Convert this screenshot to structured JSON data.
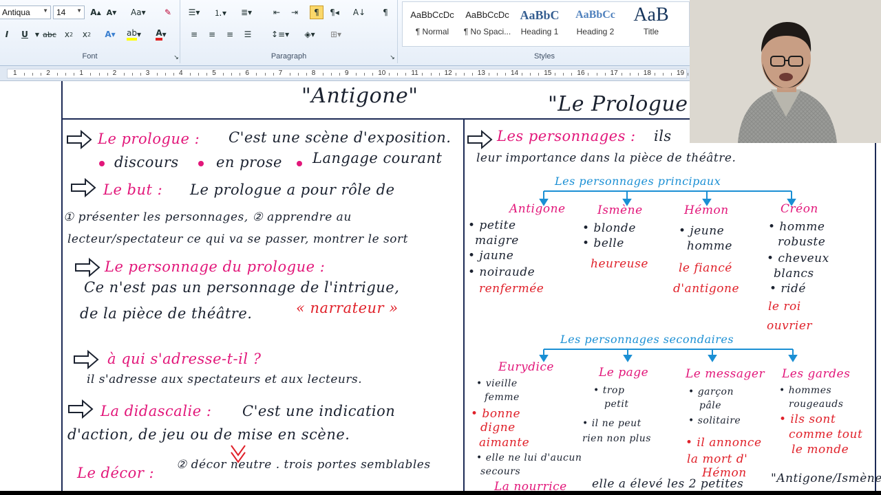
{
  "ribbon": {
    "font": {
      "font_name": "Antiqua",
      "font_size": "14",
      "group_label": "Font"
    },
    "paragraph": {
      "group_label": "Paragraph"
    },
    "styles": {
      "group_label": "Styles",
      "items": [
        {
          "sample": "AaBbCcDc",
          "name": "¶ Normal"
        },
        {
          "sample": "AaBbCcDc",
          "name": "¶ No Spaci..."
        },
        {
          "sample": "AaBbC",
          "name": "Heading 1"
        },
        {
          "sample": "AaBbCc",
          "name": "Heading 2"
        },
        {
          "sample": "AaB",
          "name": "Title"
        }
      ]
    },
    "icons": [
      "grow-font-icon",
      "shrink-font-icon",
      "change-case-icon",
      "clear-format-icon",
      "bullets-icon",
      "numbering-icon",
      "multilevel-list-icon",
      "decrease-indent-icon",
      "increase-indent-icon",
      "ltr-icon",
      "rtl-icon",
      "sort-icon",
      "show-marks-icon",
      "bold-icon",
      "italic-icon",
      "underline-icon",
      "strikethrough-icon",
      "subscript-icon",
      "superscript-icon",
      "text-effects-icon",
      "highlight-icon",
      "font-color-icon",
      "align-left-icon",
      "align-center-icon",
      "align-right-icon",
      "justify-icon",
      "line-spacing-icon",
      "shading-icon",
      "borders-icon"
    ]
  },
  "ruler": {
    "numbers": [
      "1",
      "2",
      "1",
      "2",
      "3",
      "4",
      "5",
      "6",
      "7",
      "8",
      "9",
      "10",
      "11",
      "12",
      "13",
      "14",
      "15",
      "16",
      "17",
      "18",
      "19"
    ]
  },
  "notes": {
    "title_left": "\"Antigone\"",
    "title_right": "\"Le Prologue\"",
    "left": {
      "prologue_head": "Le prologue :",
      "prologue_text": "C'est une scène d'exposition.",
      "bullet1": "discours",
      "bullet2": "en prose",
      "bullet3": "Langage courant",
      "but_head": "Le but :",
      "but_text": "Le prologue a pour rôle de",
      "but_line2": "① présenter les personnages, ② apprendre au",
      "but_line3": "lecteur/spectateur ce qui va se passer, montrer le sort",
      "perso_head": "Le personnage du prologue :",
      "perso_line1": "Ce n'est pas un personnage de l'intrigue,",
      "perso_line2": "de la pièce de théâtre.",
      "narrateur": "« narrateur »",
      "qui_head": "à qui s'adresse-t-il ?",
      "qui_text": "il s'adresse aux spectateurs et aux lecteurs.",
      "dida_head": "La didascalie :",
      "dida_text": "C'est une indication",
      "dida_line2": "d'action, de jeu ou de mise en scène.",
      "decor_head": "Le décor :",
      "decor_text": "② décor neutre . trois portes semblables"
    },
    "right": {
      "perso_head": "Les personnages :",
      "perso_text": "ils",
      "perso_line2": "leur importance dans la pièce de théâtre.",
      "principaux_label": "Les personnages principaux",
      "principaux": [
        {
          "name": "Antigone",
          "traits": [
            "• petite",
            "maigre",
            "• jaune",
            "• noiraude"
          ],
          "red": [
            "renfermée"
          ]
        },
        {
          "name": "Ismène",
          "traits": [
            "• blonde",
            "• belle"
          ],
          "red": [
            "heureuse"
          ]
        },
        {
          "name": "Hémon",
          "traits": [
            "• jeune",
            "homme"
          ],
          "red": [
            "le fiancé",
            "d'antigone"
          ]
        },
        {
          "name": "Créon",
          "traits": [
            "• homme",
            "robuste",
            "• cheveux",
            "blancs",
            "• ridé"
          ],
          "red": [
            "le roi",
            "ouvrier"
          ]
        }
      ],
      "secondaires_label": "Les personnages secondaires",
      "secondaires": [
        {
          "name": "Eurydice",
          "traits": [
            "• vieille",
            "femme"
          ],
          "red": [
            "• bonne",
            "digne",
            "aimante"
          ],
          "extra": [
            "• elle ne lui d'aucun",
            "secours"
          ]
        },
        {
          "name": "Le page",
          "traits": [
            "• trop",
            "petit",
            "• il ne peut",
            "rien non plus"
          ],
          "red": []
        },
        {
          "name": "Le messager",
          "traits": [
            "• garçon",
            "pâle",
            "• solitaire"
          ],
          "red": [
            "• il annonce",
            "la mort d'",
            "Hémon"
          ]
        },
        {
          "name": "Les gardes",
          "traits": [
            "• hommes",
            "rougeauds"
          ],
          "red": [
            "• ils sont",
            "comme tout",
            "le monde"
          ]
        }
      ],
      "nourrice_head": "La nourrice",
      "nourrice_text": "elle a élevé les 2 petites",
      "nourrice_names": "\"Antigone/Ismène\""
    }
  }
}
